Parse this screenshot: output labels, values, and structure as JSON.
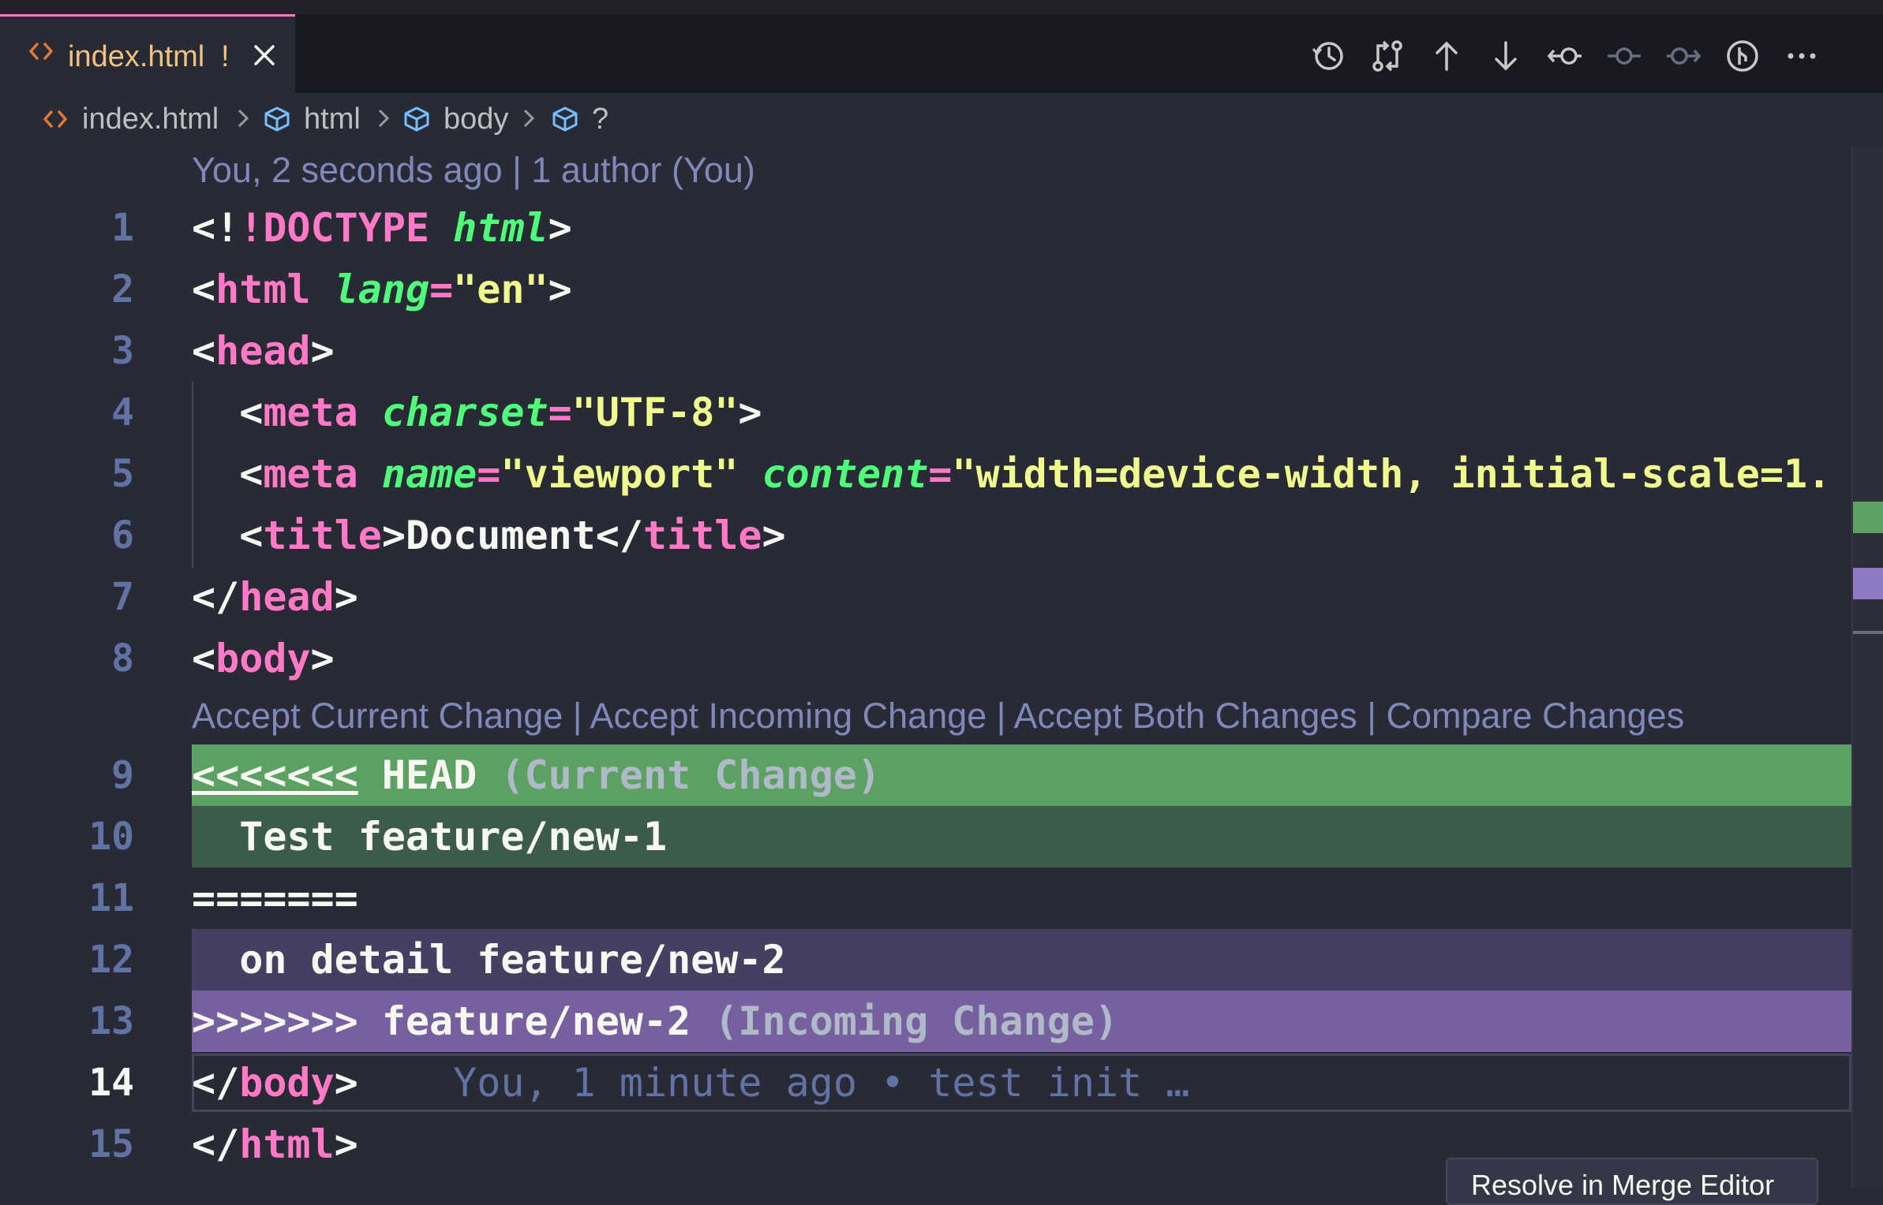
{
  "tab": {
    "filename": "index.html",
    "modified_marker": "!",
    "icon": "html-file-icon",
    "close_icon": "close-icon"
  },
  "toolbar_icons": [
    "history-icon",
    "compare-changes-icon",
    "previous-change-icon",
    "next-change-icon",
    "accept-current-icon",
    "accept-both-icon",
    "accept-incoming-icon",
    "git-merge-icon",
    "more-actions-icon"
  ],
  "breadcrumb": {
    "file": "index.html",
    "items": [
      "html",
      "body",
      "?"
    ]
  },
  "blame_header": "You, 2 seconds ago | 1 author (You)",
  "conflict_actions": {
    "accept_current": "Accept Current Change",
    "sep1": " | ",
    "accept_incoming": "Accept Incoming Change",
    "sep2": " | ",
    "accept_both": "Accept Both Changes",
    "sep3": " | ",
    "compare": "Compare Changes"
  },
  "lines": {
    "1": {
      "num": "1"
    },
    "2": {
      "num": "2"
    },
    "3": {
      "num": "3"
    },
    "4": {
      "num": "4"
    },
    "5": {
      "num": "5"
    },
    "6": {
      "num": "6"
    },
    "7": {
      "num": "7"
    },
    "8": {
      "num": "8"
    },
    "9": {
      "num": "9",
      "marker": "<<<<<<<",
      "ref": "HEAD",
      "label": "(Current Change)"
    },
    "10": {
      "num": "10",
      "text": "Test feature/new-1"
    },
    "11": {
      "num": "11",
      "text": "======="
    },
    "12": {
      "num": "12",
      "text": "on detail feature/new-2"
    },
    "13": {
      "num": "13",
      "marker": ">>>>>>>",
      "ref": "feature/new-2",
      "label": "(Incoming Change)"
    },
    "14": {
      "num": "14",
      "blame": "You, 1 minute ago • test init …"
    },
    "15": {
      "num": "15"
    }
  },
  "code": {
    "doctype": "!DOCTYPE",
    "html": "html",
    "lang": "lang",
    "en": "\"en\"",
    "head": "head",
    "meta": "meta",
    "charset": "charset",
    "utf8": "\"UTF-8\"",
    "name": "name",
    "viewport": "\"viewport\"",
    "content": "content",
    "content_val": "\"width=device-width, initial-scale=1.",
    "title": "title",
    "document": "Document",
    "body": "body"
  },
  "hover_button": "Resolve in Merge Editor",
  "colors": {
    "current_header": "#5ca163",
    "current_body": "#3c5b49",
    "incoming_body": "#453f62",
    "incoming_header": "#76609f",
    "tag": "#ff79c6",
    "attr": "#50fa7b",
    "string": "#f1fa8c"
  }
}
